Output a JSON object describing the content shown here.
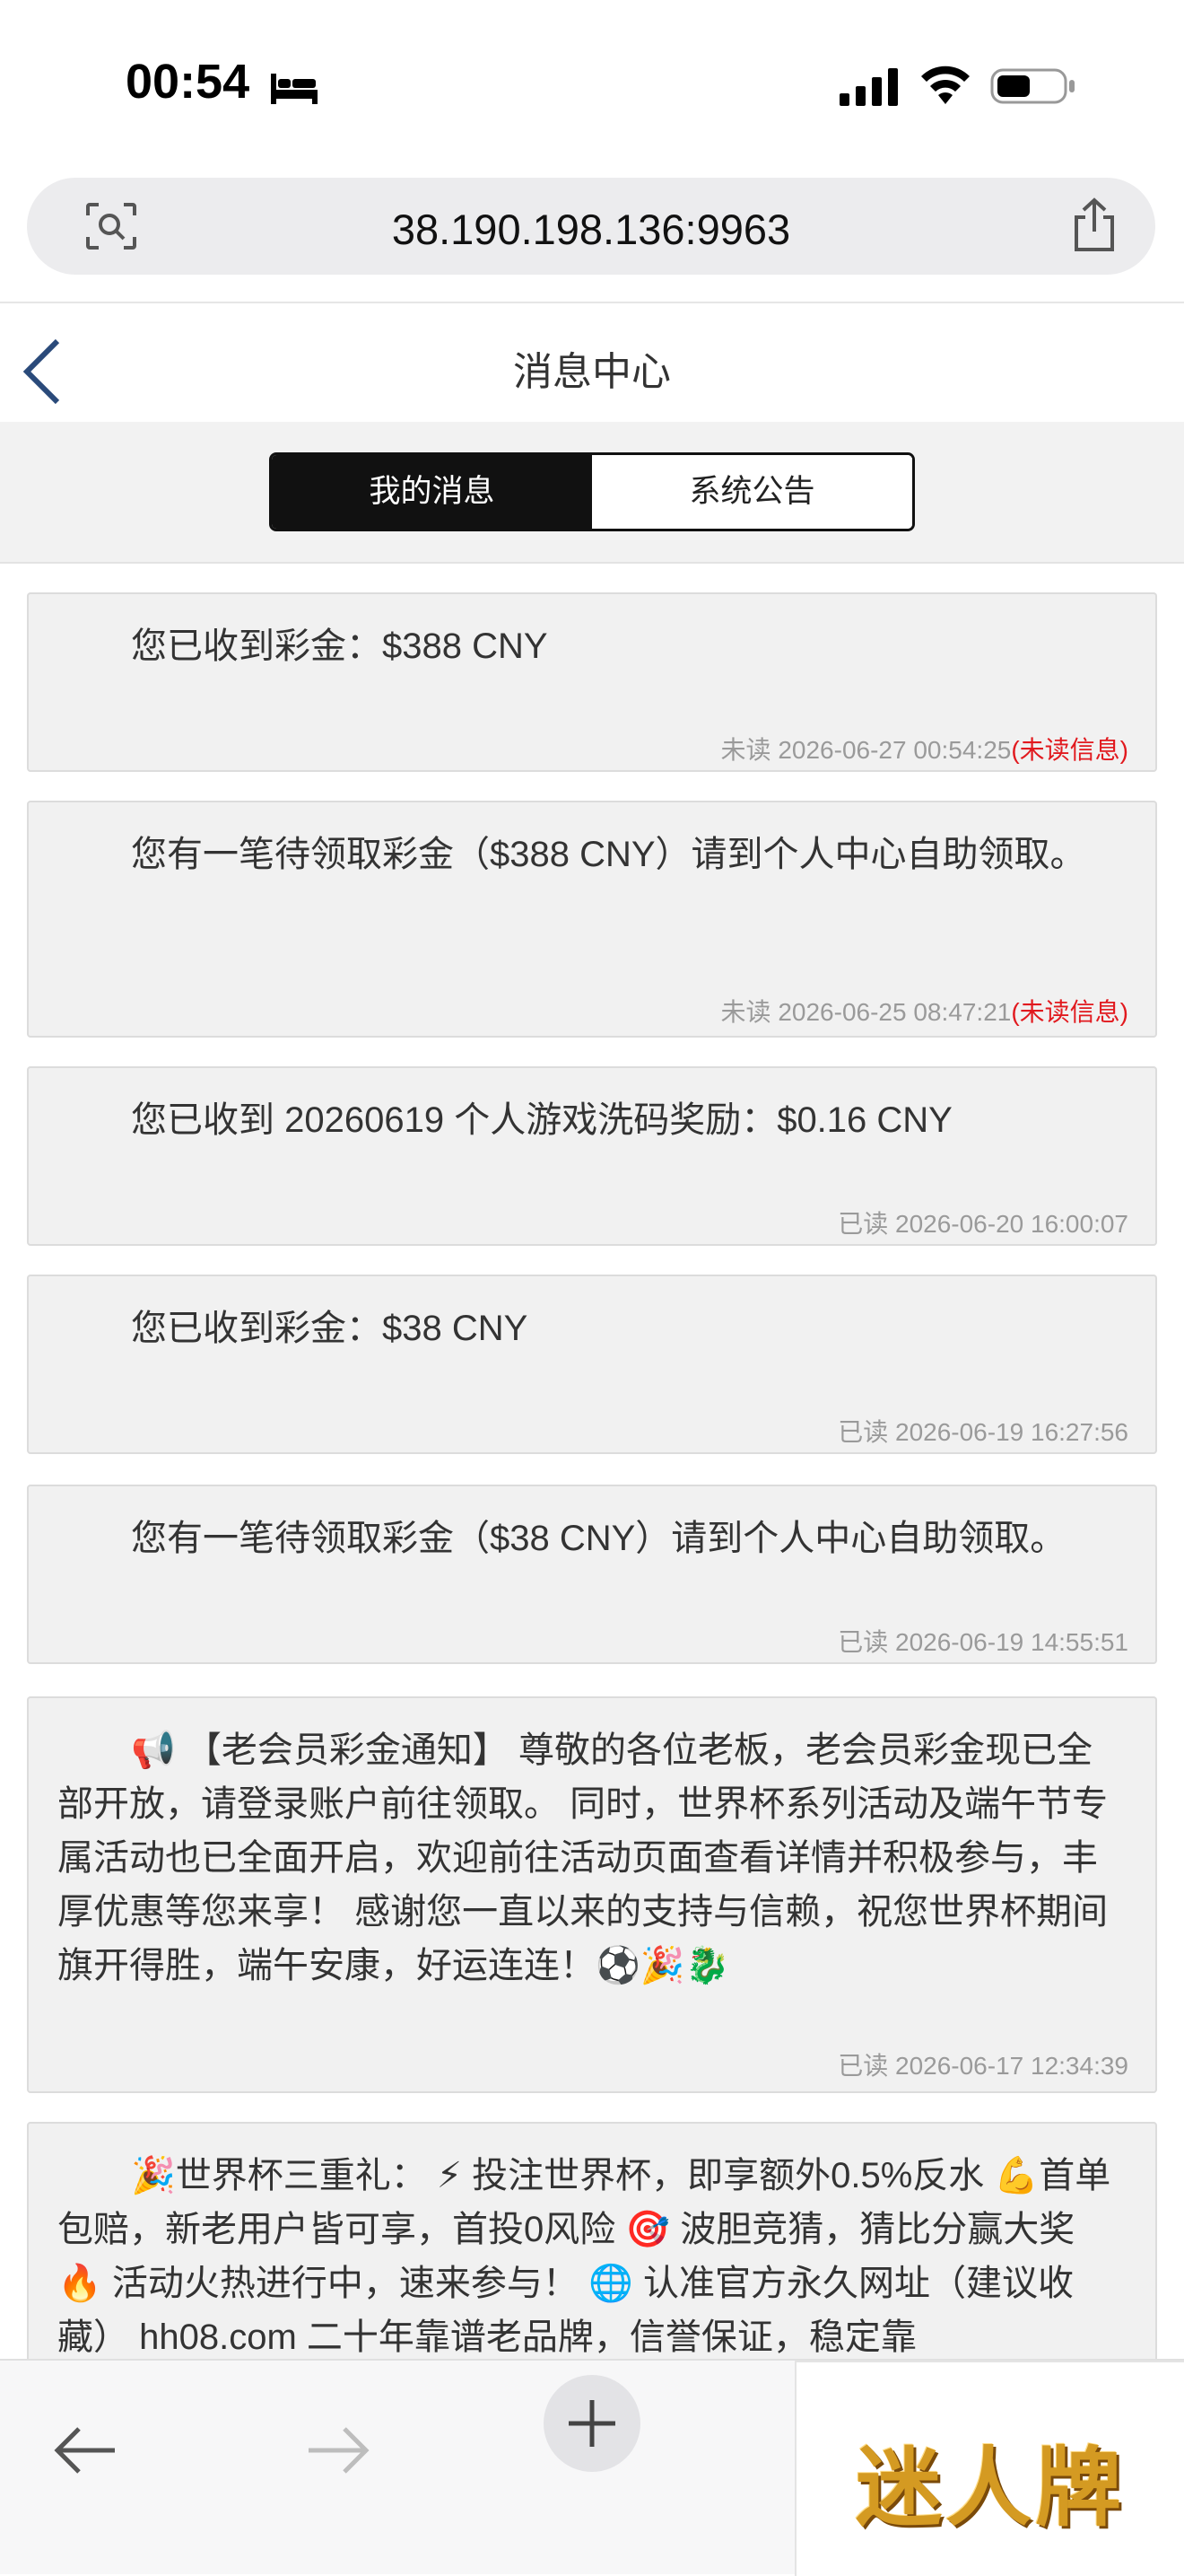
{
  "status_bar": {
    "time": "00:54",
    "icons": [
      "bed-icon",
      "signal-icon",
      "wifi-icon",
      "battery-icon"
    ]
  },
  "browser": {
    "url": "38.190.198.136:9963",
    "left_icon": "reader-icon",
    "right_icon": "share-icon"
  },
  "header": {
    "title": "消息中心",
    "back_icon": "chevron-left-icon"
  },
  "tabs": [
    {
      "label": "我的消息",
      "active": true
    },
    {
      "label": "系统公告",
      "active": false
    }
  ],
  "messages": [
    {
      "text": "您已收到彩金：$388 CNY",
      "status": "未读",
      "timestamp": "2026-06-27 00:54:25",
      "flag": "(未读信息)"
    },
    {
      "text": "您有一笔待领取彩金（$388 CNY）请到个人中心自助领取。",
      "status": "未读",
      "timestamp": "2026-06-25 08:47:21",
      "flag": "(未读信息)"
    },
    {
      "text": "您已收到 20260619 个人游戏洗码奖励：$0.16 CNY",
      "status": "已读",
      "timestamp": "2026-06-20 16:00:07",
      "flag": ""
    },
    {
      "text": "您已收到彩金：$38 CNY",
      "status": "已读",
      "timestamp": "2026-06-19 16:27:56",
      "flag": ""
    },
    {
      "text": "您有一笔待领取彩金（$38 CNY）请到个人中心自助领取。",
      "status": "已读",
      "timestamp": "2026-06-19 14:55:51",
      "flag": ""
    },
    {
      "text": "📢 【老会员彩金通知】 尊敬的各位老板，老会员彩金现已全部开放，请登录账户前往领取。 同时，世界杯系列活动及端午节专属活动也已全面开启，欢迎前往活动页面查看详情并积极参与，丰厚优惠等您来享！ 感谢您一直以来的支持与信赖，祝您世界杯期间旗开得胜，端午安康，好运连连！⚽🎉🐉",
      "status": "已读",
      "timestamp": "2026-06-17 12:34:39",
      "flag": ""
    },
    {
      "text": "🎉世界杯三重礼： ⚡ 投注世界杯，即享额外0.5%反水 💪首单包赔，新老用户皆可享，首投0风险 🎯 波胆竞猜，猜比分赢大奖 🔥 活动火热进行中，速来参与！ 🌐 认准官方永久网址（建议收藏） hh08.com 二十年靠谱老品牌，信誉保证，稳定靠",
      "status": "",
      "timestamp": "",
      "flag": ""
    }
  ],
  "toolbar": {
    "icons": [
      "back-arrow-icon",
      "forward-arrow-icon",
      "plus-icon"
    ]
  },
  "watermark": {
    "text": "迷人牌"
  }
}
